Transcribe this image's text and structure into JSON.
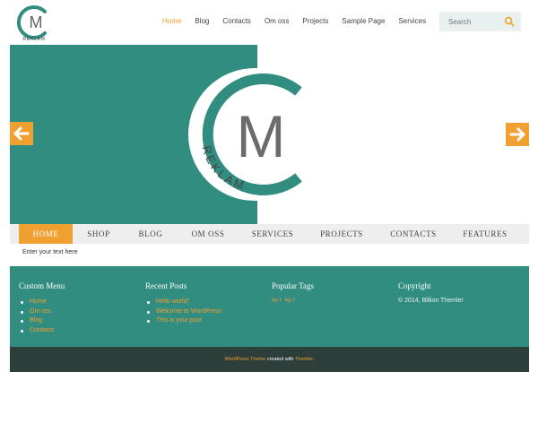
{
  "header": {
    "logo_small_text": "REKLAM",
    "nav": [
      "Home",
      "Blog",
      "Contacts",
      "Om oss",
      "Projects",
      "Sample Page",
      "Services"
    ],
    "search_placeholder": "Search",
    "search_icon": "magnifier-icon"
  },
  "slider": {
    "logo_letter": "M",
    "logo_text": "REKLAM",
    "prev_icon": "arrow-left-icon",
    "next_icon": "arrow-right-icon"
  },
  "menu": {
    "items": [
      "HOME",
      "SHOP",
      "BLOG",
      "OM OSS",
      "SERVICES",
      "PROJECTS",
      "CONTACTS",
      "FEATURES"
    ]
  },
  "content": {
    "text": "Enter your text here"
  },
  "footer": {
    "custom_menu": {
      "title": "Custom Menu",
      "items": [
        "Home",
        "Om oss",
        "Blog",
        "Contacts"
      ]
    },
    "recent_posts": {
      "title": "Recent Posts",
      "items": [
        "Hello world!",
        "Welcome to WordPress",
        "This is your post"
      ]
    },
    "popular_tags": {
      "title": "Popular Tags",
      "tags": [
        "tag 1",
        "tag 2"
      ]
    },
    "copyright": {
      "title": "Copyright",
      "text": "© 2014, Billion Themler"
    }
  },
  "bottom": {
    "link1": "WordPress Theme",
    "middle": " created with ",
    "link2": "Themler",
    "end": "."
  },
  "colors": {
    "teal": "#328d81",
    "orange": "#f0a030",
    "dark": "#2c3f3b",
    "menu_bg": "#eeeeee"
  }
}
